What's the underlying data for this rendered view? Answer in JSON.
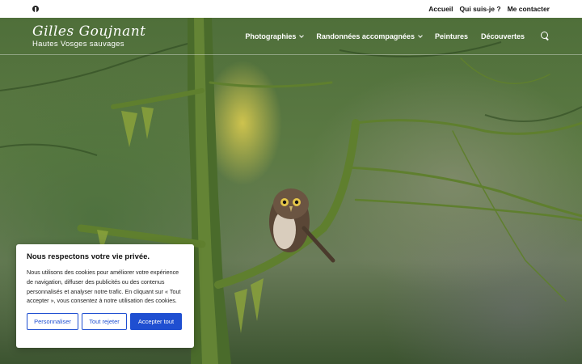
{
  "topbar": {
    "social_icon": "facebook-icon",
    "links": [
      "Accueil",
      "Qui suis-je ?",
      "Me contacter"
    ]
  },
  "logo": {
    "title": "Gilles Goujnant",
    "subtitle": "Hautes Vosges sauvages"
  },
  "menu": {
    "items": [
      {
        "label": "Photographies",
        "has_dropdown": true
      },
      {
        "label": "Randonnées accompagnées",
        "has_dropdown": true
      },
      {
        "label": "Peintures",
        "has_dropdown": false
      },
      {
        "label": "Découvertes",
        "has_dropdown": false
      }
    ],
    "search_icon": "search-icon"
  },
  "cookie": {
    "title": "Nous respectons votre vie privée.",
    "text": "Nous utilisons des cookies pour améliorer votre expérience de navigation, diffuser des publicités ou des contenus personnalisés et analyser notre trafic. En cliquant sur « Tout accepter », vous consentez à notre utilisation des cookies.",
    "customize": "Personnaliser",
    "reject": "Tout rejeter",
    "accept": "Accepter tout"
  },
  "colors": {
    "accent": "#1f4fd1"
  }
}
